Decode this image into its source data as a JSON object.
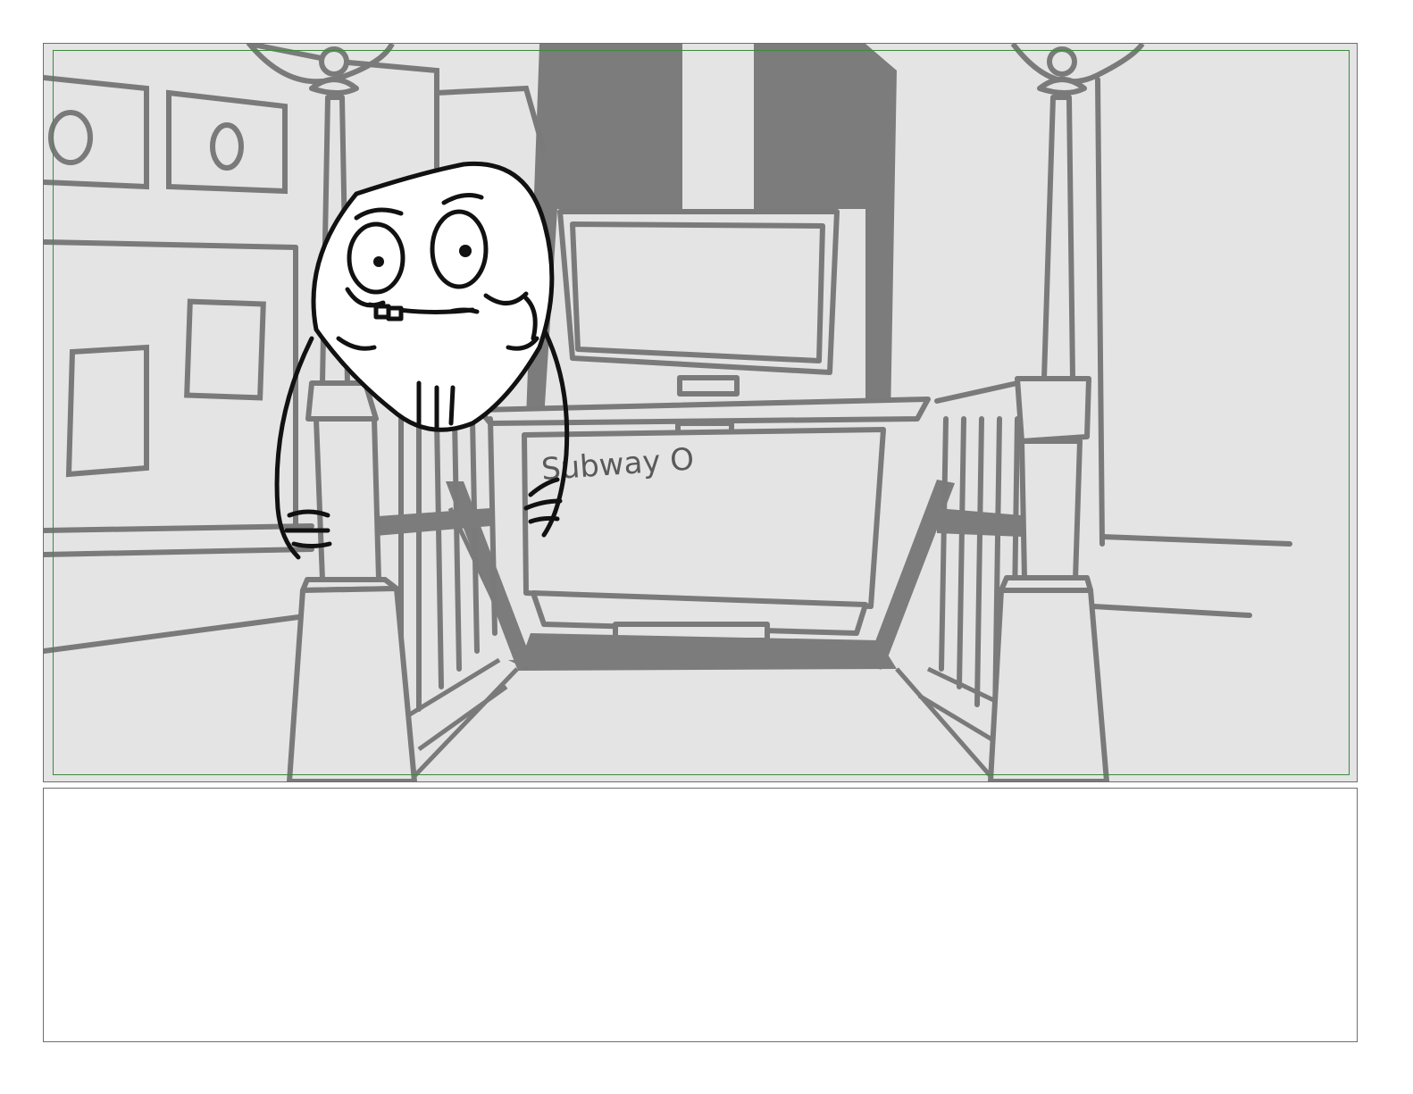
{
  "storyboard": {
    "panel": {
      "scene": "subway-entrance",
      "sign_text": "Subway O"
    },
    "colors": {
      "background": "#e4e4e4",
      "scenery_line": "#7a7a7a",
      "shadow_fill": "#7c7c7c",
      "character_line": "#111111",
      "character_fill": "#ffffff",
      "safe_frame": "#3c8a3c",
      "frame_border": "#6e6e6e"
    },
    "notes": {
      "text": ""
    }
  }
}
